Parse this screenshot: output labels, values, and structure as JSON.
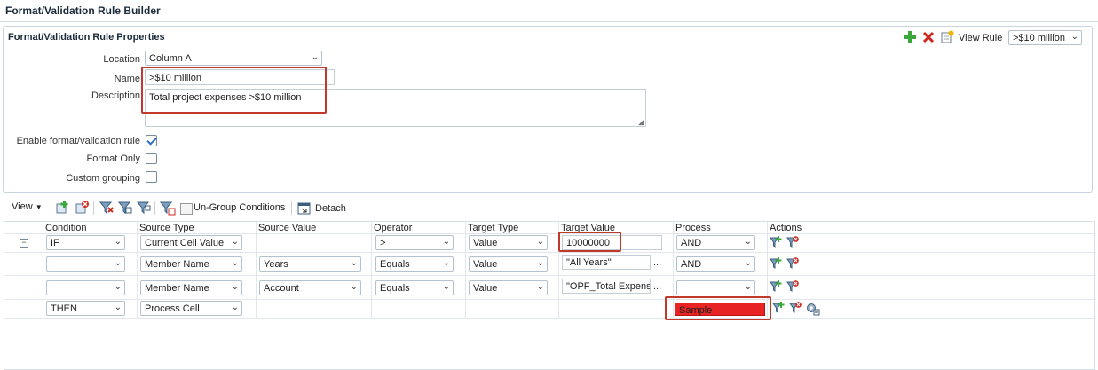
{
  "page_title": "Format/Validation Rule Builder",
  "props": {
    "title": "Format/Validation Rule Properties",
    "location_label": "Location",
    "location_value": "Column A",
    "name_label": "Name",
    "name_value": ">$10 million",
    "description_label": "Description",
    "description_value": "Total project expenses >$10 million",
    "enable_label": "Enable format/validation rule",
    "enable_checked": true,
    "format_only_label": "Format Only",
    "custom_grouping_label": "Custom grouping",
    "view_rule_label": "View Rule",
    "view_rule_value": ">$10 million"
  },
  "toolbar": {
    "view_label": "View",
    "ungroup_label": "Un-Group Conditions",
    "detach_label": "Detach"
  },
  "grid": {
    "headers": {
      "condition": "Condition",
      "source_type": "Source Type",
      "source_value": "Source Value",
      "operator": "Operator",
      "target_type": "Target Type",
      "target_value": "Target Value",
      "process": "Process",
      "actions": "Actions"
    },
    "rows": [
      {
        "condition": "IF",
        "source_type": "Current Cell Value",
        "source_value": "",
        "operator": ">",
        "target_type": "Value",
        "target_value": "10000000",
        "process": "AND"
      },
      {
        "condition": "",
        "source_type": "Member Name",
        "source_value": "Years",
        "operator": "Equals",
        "target_type": "Value",
        "target_value": "\"All Years\"",
        "process": "AND"
      },
      {
        "condition": "",
        "source_type": "Member Name",
        "source_value": "Account",
        "operator": "Equals",
        "target_type": "Value",
        "target_value": "\"OPF_Total Expense",
        "process": ""
      },
      {
        "condition": "THEN",
        "source_type": "Process Cell",
        "process": "Sample"
      }
    ],
    "ellipsis": "...",
    "collapse_glyph": "−",
    "sample_color": "#e82323"
  }
}
